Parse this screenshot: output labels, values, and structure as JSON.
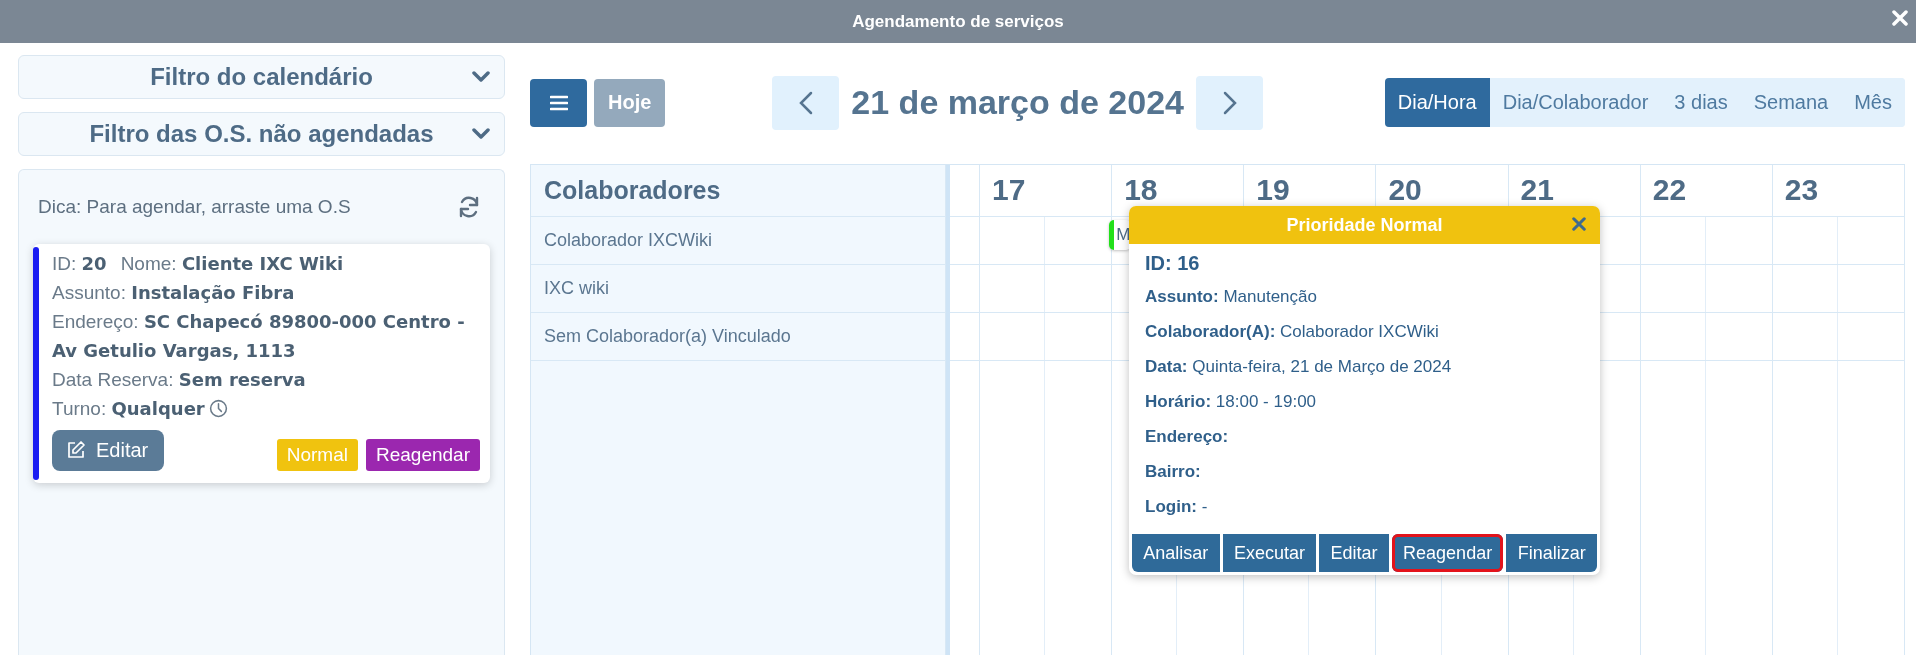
{
  "window": {
    "title": "Agendamento de serviços"
  },
  "sidebar": {
    "filters": [
      {
        "label": "Filtro do calendário",
        "expanded": false
      },
      {
        "label": "Filtro das O.S. não agendadas",
        "expanded": false
      }
    ],
    "hint": "Dica: Para agendar, arraste uma O.S",
    "orders": [
      {
        "color": "#1a1cf2",
        "lines": [
          [
            "ID: **20**",
            "Nome: **Cliente IXC Wiki**"
          ],
          [
            "Assunto: **Instalação Fibra**"
          ],
          [
            "Endereço: **SC Chapecó 89800-000 Centro - Av Getulio Vargas, 1113**"
          ],
          [
            "Data Reserva: **Sem reserva**"
          ],
          [
            "Turno: **Qualquer**"
          ]
        ],
        "edit_button": "Editar",
        "tags": [
          {
            "label": "Normal",
            "color": "#f0c30f"
          },
          {
            "label": "Reagendar",
            "color": "#9b27af"
          }
        ]
      }
    ]
  },
  "toolbar": {
    "today": "Hoje",
    "date": "21 de março de 2024",
    "views": [
      {
        "label": "Dia/Hora",
        "selected": true
      },
      {
        "label": "Dia/Colaborador",
        "selected": false
      },
      {
        "label": "3 dias",
        "selected": false
      },
      {
        "label": "Semana",
        "selected": false
      },
      {
        "label": "Mês",
        "selected": false
      }
    ]
  },
  "calendar": {
    "resource_header": "Colaboradores",
    "resources": [
      {
        "name": "Colaborador IXCWiki",
        "events": [
          {
            "label": "M",
            "color": "#22e01a"
          }
        ]
      },
      {
        "name": "IXC wiki"
      },
      {
        "name": "Sem Colaborador(a) Vinculado"
      }
    ],
    "days": [
      "17",
      "18",
      "19",
      "20",
      "21",
      "22",
      "23"
    ]
  },
  "popup": {
    "title": "Prioridade Normal",
    "id": "ID: 16",
    "details": [
      "**Assunto:** Manutenção",
      "**Colaborador(A):** Colaborador IXCWiki",
      "**Data:** Quinta-feira, 21 de Março de 2024",
      "**Horário:** 18:00 - 19:00",
      "**Endereço:**",
      "**Bairro:**",
      "**Login:** -"
    ],
    "actions": [
      {
        "label": "Analisar",
        "highlighted": false
      },
      {
        "label": "Executar",
        "highlighted": false
      },
      {
        "label": "Editar",
        "highlighted": false
      },
      {
        "label": "Reagendar",
        "highlighted": true
      },
      {
        "label": "Finalizar",
        "highlighted": false
      }
    ]
  }
}
